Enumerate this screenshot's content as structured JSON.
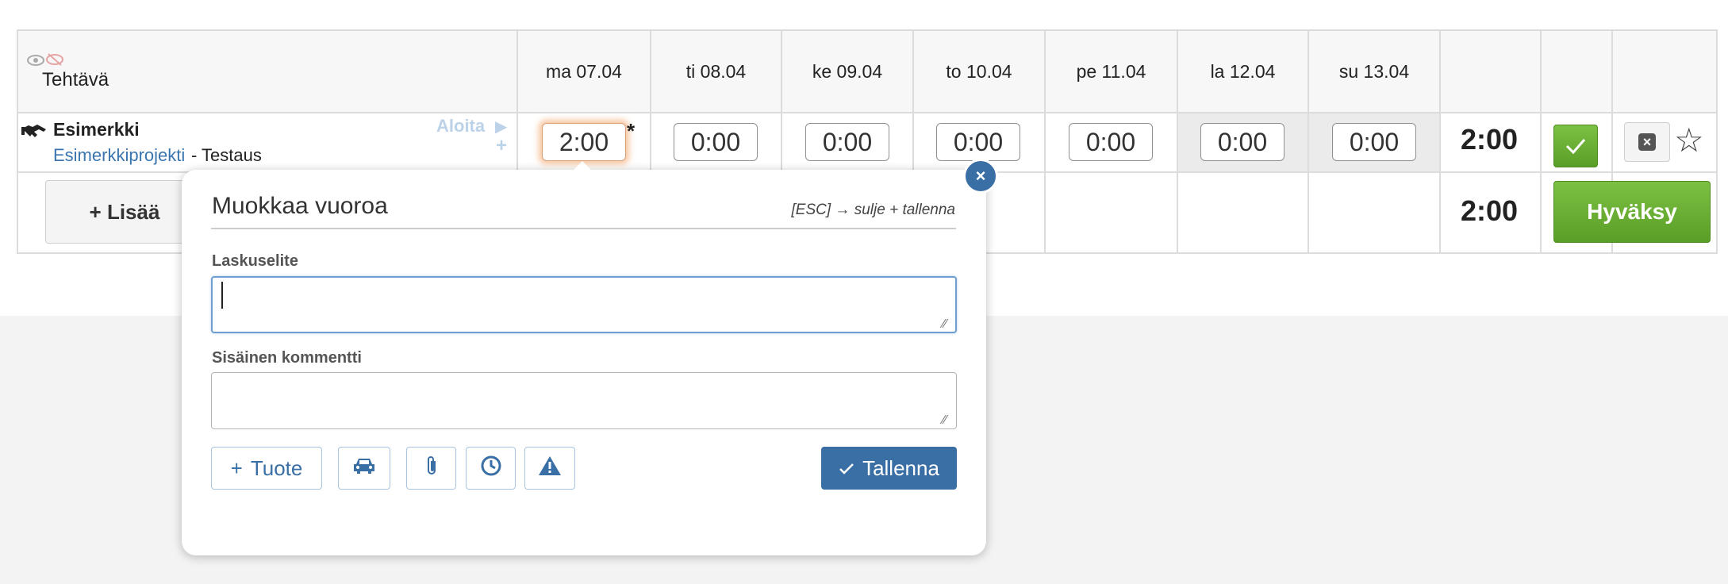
{
  "header": {
    "task_label": "Tehtävä",
    "days": [
      "ma 07.04",
      "ti 08.04",
      "ke 09.04",
      "to 10.04",
      "pe 11.04",
      "la 12.04",
      "su 13.04"
    ]
  },
  "row": {
    "task_name": "Esimerkki",
    "project": "Esimerkkiprojekti",
    "separator": "- Testaus",
    "start_label": "Aloita",
    "add_symbol": "+",
    "times": [
      "2:00",
      "0:00",
      "0:00",
      "0:00",
      "0:00",
      "0:00",
      "0:00"
    ],
    "modified_marker": "*",
    "total": "2:00"
  },
  "footer": {
    "add_label": "+ Lisää",
    "total": "2:00",
    "approve_label": "Hyväksy"
  },
  "popup": {
    "title": "Muokkaa vuoroa",
    "hint": "[ESC] → sulje + tallenna",
    "close_symbol": "×",
    "invoice_label": "Laskuselite",
    "invoice_value": "",
    "comment_label": "Sisäinen kommentti",
    "comment_value": "",
    "product_label": "Tuote",
    "save_label": "Tallenna"
  },
  "icons": {
    "hdr_show": "eye-icon",
    "hdr_hide": "eye-off-icon",
    "task": "handshake-icon",
    "approve_row": "check-icon",
    "delete": "close-box-icon",
    "favorite": "star-icon",
    "car": "car-icon",
    "attach": "paperclip-icon",
    "time": "clock-icon",
    "warning": "warning-icon"
  },
  "colors": {
    "accent": "#3a6fa6",
    "approve": "#6aae34",
    "link": "#3a75b0"
  }
}
